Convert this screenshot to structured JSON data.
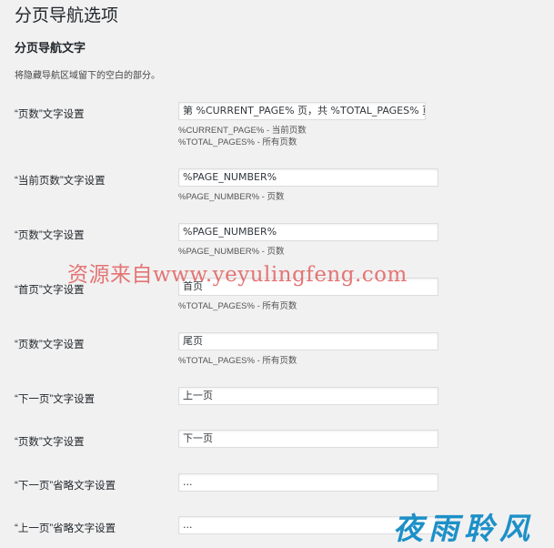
{
  "page": {
    "title": "分页导航选项",
    "section_title": "分页导航文字",
    "section_desc": "将隐藏导航区域留下的空白的部分。"
  },
  "fields": [
    {
      "label": "“页数”文字设置",
      "value": "第 %CURRENT_PAGE% 页，共 %TOTAL_PAGES% 页",
      "hints": [
        "%CURRENT_PAGE% - 当前页数",
        "%TOTAL_PAGES% - 所有页数"
      ]
    },
    {
      "label": "“当前页数”文字设置",
      "value": "%PAGE_NUMBER%",
      "hints": [
        "%PAGE_NUMBER% - 页数"
      ]
    },
    {
      "label": "“页数”文字设置",
      "value": "%PAGE_NUMBER%",
      "hints": [
        "%PAGE_NUMBER% - 页数"
      ]
    },
    {
      "label": "“首页”文字设置",
      "value": "首页",
      "hints": [
        "%TOTAL_PAGES% - 所有页数"
      ]
    },
    {
      "label": "“页数”文字设置",
      "value": "尾页",
      "hints": [
        "%TOTAL_PAGES% - 所有页数"
      ]
    },
    {
      "label": "“下一页”文字设置",
      "value": "上一页",
      "hints": []
    },
    {
      "label": "“页数”文字设置",
      "value": "下一页",
      "hints": []
    },
    {
      "label": "“下一页”省略文字设置",
      "value": "...",
      "hints": []
    },
    {
      "label": "“上一页”省略文字设置",
      "value": "...",
      "hints": []
    }
  ],
  "watermark": {
    "text": "资源来自www.yeyulingfeng.com",
    "brand": "夜雨聆风",
    "text_color": "#e36a6a",
    "brand_color": "#1d90c8"
  }
}
